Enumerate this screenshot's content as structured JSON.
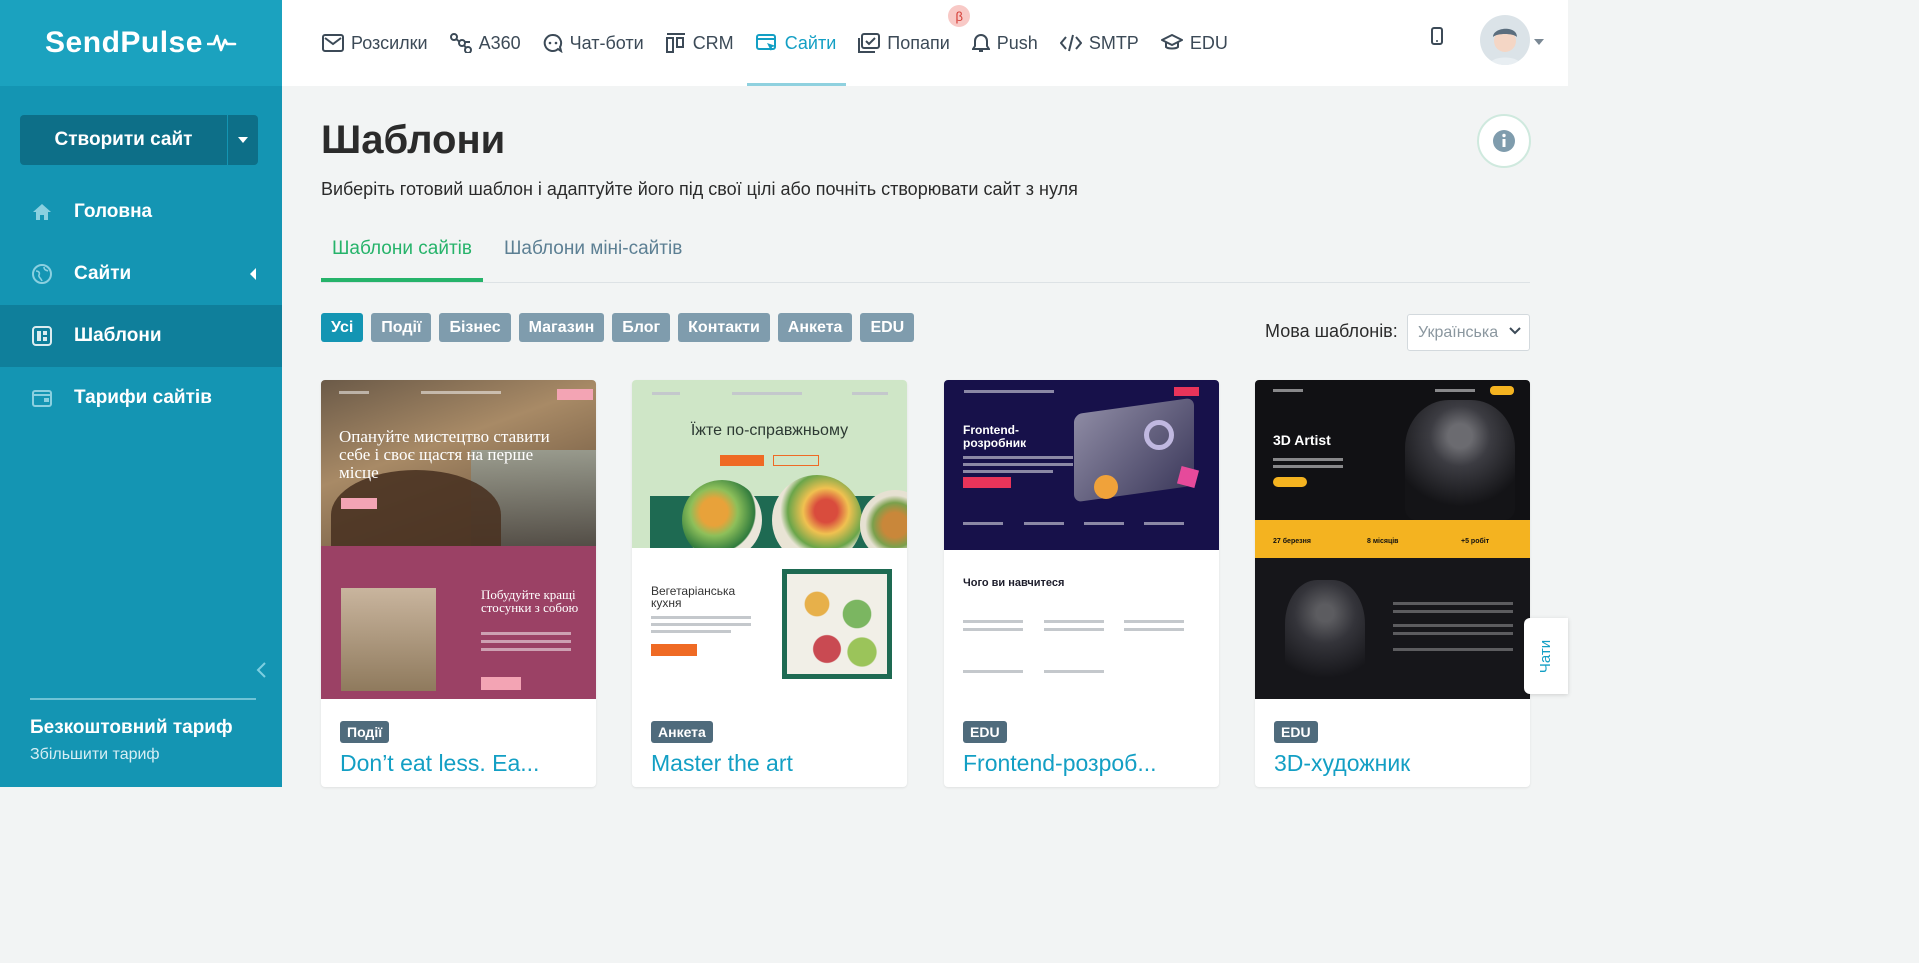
{
  "app": {
    "logo": "SendPulse"
  },
  "sidebar": {
    "create_button": "Створити сайт",
    "items": [
      {
        "label": "Головна",
        "icon": "home-icon"
      },
      {
        "label": "Сайти",
        "icon": "globe-icon"
      },
      {
        "label": "Шаблони",
        "icon": "templates-icon",
        "active": true
      },
      {
        "label": "Тарифи сайтів",
        "icon": "wallet-icon"
      }
    ],
    "plan_name": "Безкоштовний тариф",
    "plan_upgrade": "Збільшити тариф"
  },
  "topnav": {
    "items": [
      {
        "label": "Розсилки",
        "icon": "mail-icon"
      },
      {
        "label": "A360",
        "icon": "automation-icon"
      },
      {
        "label": "Чат-боти",
        "icon": "chatbot-icon"
      },
      {
        "label": "CRM",
        "icon": "crm-icon"
      },
      {
        "label": "Сайти",
        "icon": "sites-icon",
        "active": true
      },
      {
        "label": "Попапи",
        "icon": "popup-icon"
      },
      {
        "label": "Push",
        "icon": "bell-icon"
      },
      {
        "label": "SMTP",
        "icon": "code-icon"
      },
      {
        "label": "EDU",
        "icon": "graduation-icon"
      }
    ],
    "beta_badge": "β"
  },
  "main": {
    "title": "Шаблони",
    "subtitle": "Виберіть готовий шаблон і адаптуйте його під свої цілі або почніть створювати сайт з нуля",
    "tabs": [
      {
        "label": "Шаблони сайтів",
        "active": true
      },
      {
        "label": "Шаблони міні-сайтів"
      }
    ],
    "filters": [
      "Усі",
      "Події",
      "Бізнес",
      "Магазин",
      "Блог",
      "Контакти",
      "Анкета",
      "EDU"
    ],
    "active_filter": "Усі",
    "language_label": "Мова шаблонів:",
    "language_value": "Українська"
  },
  "cards": [
    {
      "tag": "Події",
      "title": "Don’t eat less. Ea...",
      "preview": {
        "heading": "Опануйте мистецтво ставити себе і своє щастя на перше місце",
        "subheading": "Побудуйте кращі стосунки з собою"
      }
    },
    {
      "tag": "Анкета",
      "title": "Master the art",
      "preview": {
        "heading": "Їжте по-справжньому",
        "subheading": "Вегетаріанська кухня"
      }
    },
    {
      "tag": "EDU",
      "title": "Frontend-розроб...",
      "preview": {
        "heading": "Frontend-розробник",
        "subheading": "Чого ви навчитеся"
      }
    },
    {
      "tag": "EDU",
      "title": "3D-художник",
      "preview": {
        "heading": "3D Artist",
        "band": [
          "27 березня",
          "8 місяців",
          "+5 робіт"
        ]
      }
    }
  ],
  "chat_tab": "Чати",
  "colors": {
    "sidebar": "#1495b3",
    "accent": "#139fc4",
    "green": "#26b36a",
    "chip": "#7f9cad"
  }
}
